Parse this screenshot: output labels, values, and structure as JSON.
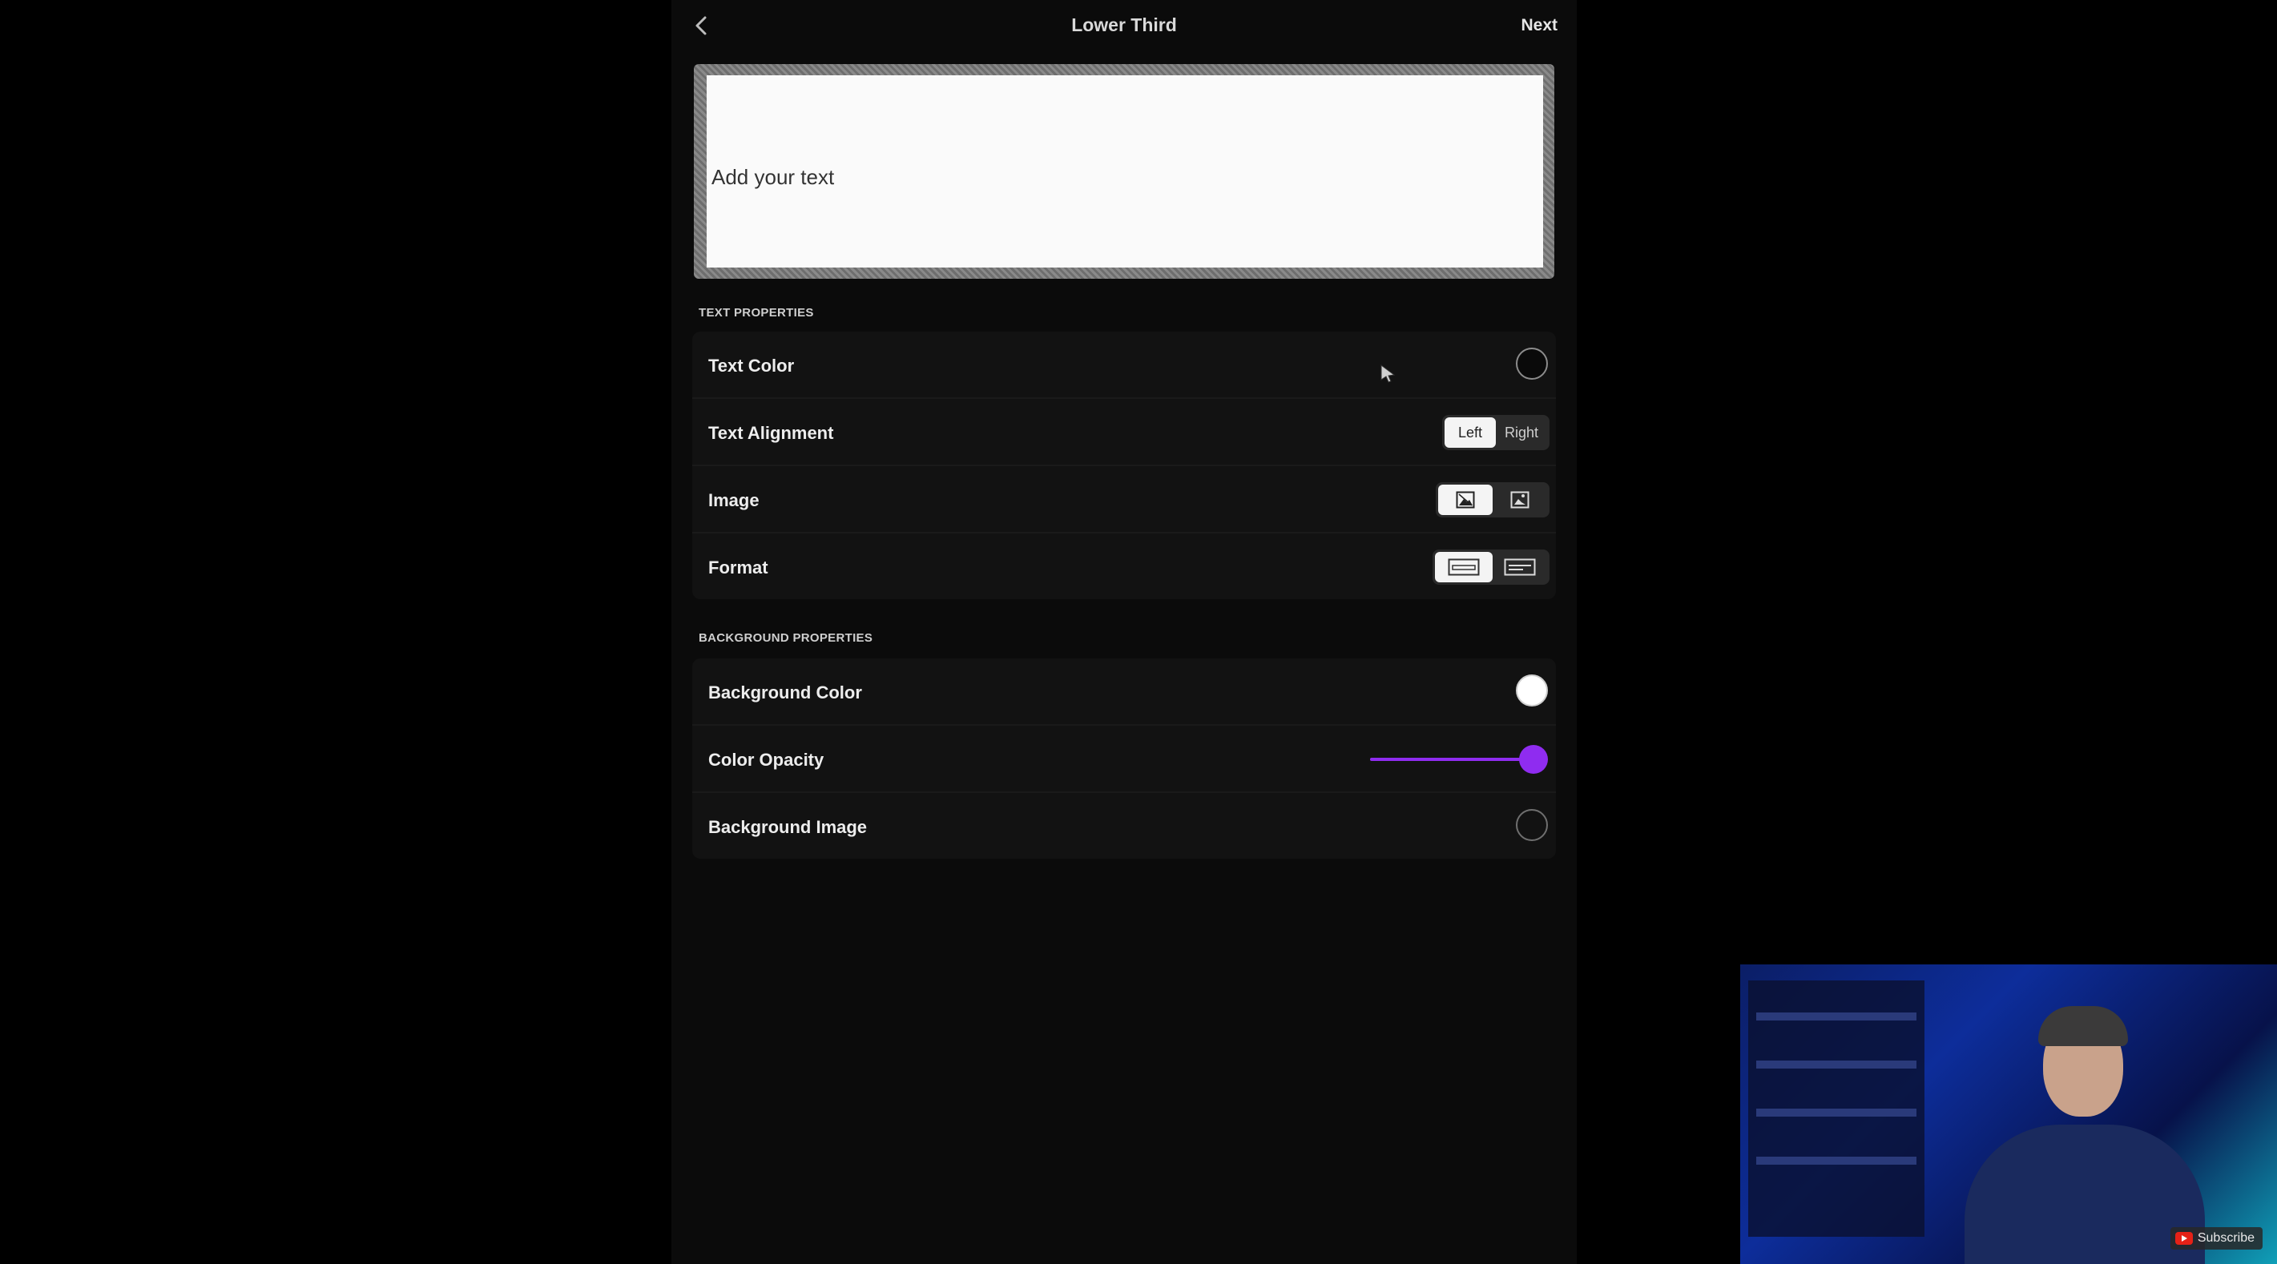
{
  "nav": {
    "title": "Lower Third",
    "next_label": "Next"
  },
  "preview": {
    "placeholder_text": "Add your text"
  },
  "text_properties": {
    "header": "TEXT PROPERTIES",
    "text_color_label": "Text Color",
    "text_color_value": "#0a0a0a",
    "text_alignment_label": "Text Alignment",
    "alignment_options": [
      "Left",
      "Right"
    ],
    "alignment_selected": "Left",
    "image_label": "Image",
    "image_options": [
      "image-filled-icon",
      "image-outline-icon"
    ],
    "format_label": "Format",
    "format_options": [
      "format-bar-icon",
      "format-box-icon"
    ]
  },
  "background_properties": {
    "header": "BACKGROUND PROPERTIES",
    "background_color_label": "Background Color",
    "background_color_value": "#ffffff",
    "color_opacity_label": "Color Opacity",
    "color_opacity_value": 1.0,
    "background_image_label": "Background Image"
  },
  "colors": {
    "accent": "#8f2cf0",
    "panel_bg": "#0b0b0b",
    "row_bg": "#121212"
  },
  "overlay": {
    "subscribe_label": "Subscribe"
  }
}
